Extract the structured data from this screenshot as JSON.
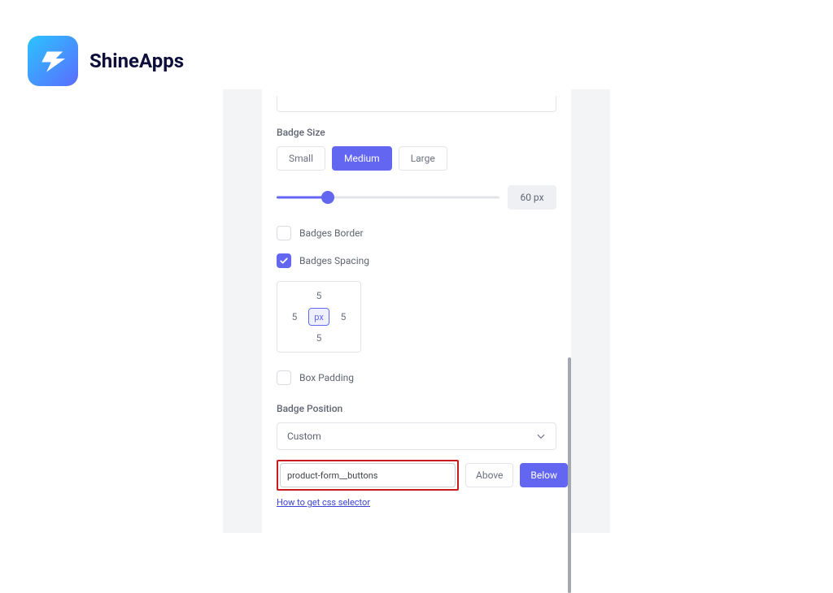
{
  "brand": {
    "name": "ShineApps"
  },
  "sections": {
    "badge_size_label": "Badge Size",
    "badge_position_label": "Badge Position"
  },
  "size_options": {
    "small": "Small",
    "medium": "Medium",
    "large": "Large",
    "selected": "Medium"
  },
  "slider": {
    "value_display": "60 px"
  },
  "checks": {
    "border_label": "Badges Border",
    "spacing_label": "Badges Spacing",
    "box_padding_label": "Box Padding"
  },
  "spacing_box": {
    "top": "5",
    "right": "5",
    "bottom": "5",
    "left": "5",
    "unit": "px"
  },
  "position_select": {
    "value": "Custom"
  },
  "custom_selector_value": "product-form__buttons",
  "placement": {
    "above": "Above",
    "below": "Below",
    "selected": "Below"
  },
  "helper_link": "How to get css selector"
}
